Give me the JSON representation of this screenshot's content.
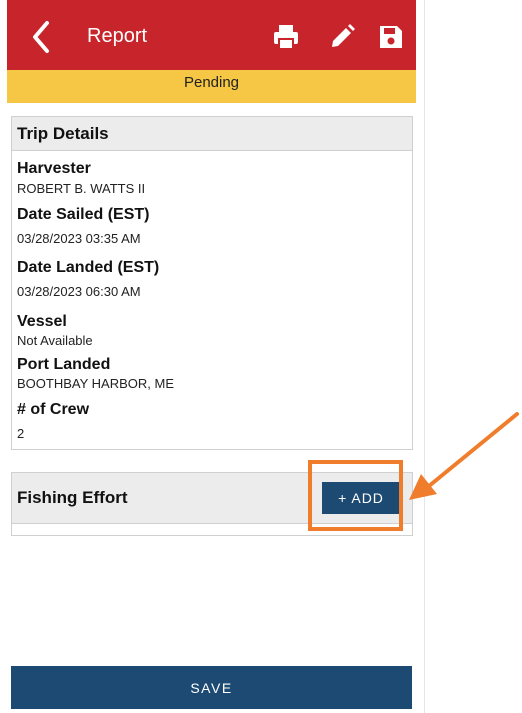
{
  "appbar": {
    "title": "Report",
    "icons": [
      "back-icon",
      "print-icon",
      "pencil-icon",
      "save-icon"
    ],
    "color": "#c8242b"
  },
  "status": {
    "label": "Pending",
    "color": "#f6c744"
  },
  "trip_details": {
    "header": "Trip Details",
    "fields": [
      {
        "label": "Harvester",
        "value": "ROBERT B. WATTS II"
      },
      {
        "label": "Date Sailed (EST)",
        "value": "03/28/2023 03:35 AM"
      },
      {
        "label": "Date Landed (EST)",
        "value": "03/28/2023 06:30 AM"
      },
      {
        "label": "Vessel",
        "value": "Not Available"
      },
      {
        "label": "Port Landed",
        "value": "BOOTHBAY HARBOR, ME"
      },
      {
        "label": "# of Crew",
        "value": "2"
      }
    ]
  },
  "fishing_effort": {
    "header": "Fishing Effort",
    "add_label": "+ ADD"
  },
  "footer": {
    "save_label": "SAVE",
    "color": "#1d4a73"
  },
  "annotation": {
    "highlight_color": "#ef7d2c"
  }
}
